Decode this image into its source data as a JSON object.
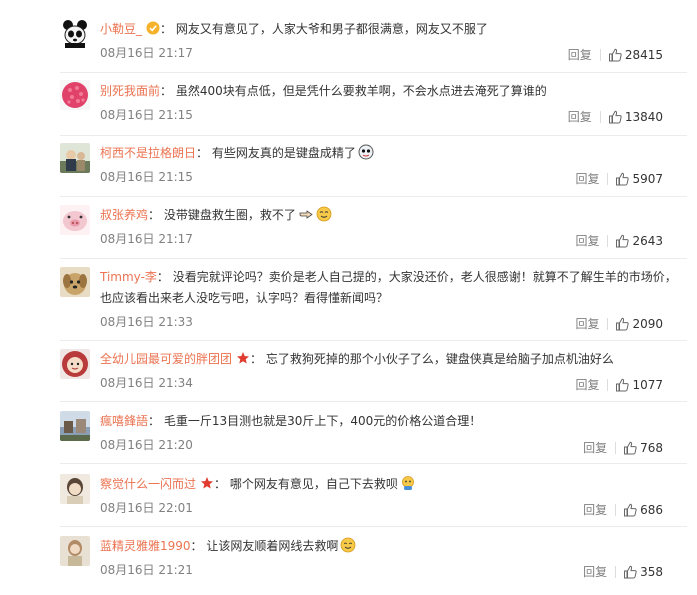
{
  "comments": [
    {
      "name": "小勒豆_",
      "text": "网友又有意见了，人家大爷和男子都很满意，网友又不服了",
      "time": "08月16日 21:17",
      "reply": "回复",
      "likes": "28415",
      "avatar_color": "#ffffff"
    },
    {
      "name": "别死我面前",
      "text": "虽然400块有点低，但是凭什么要救羊啊，不会水点进去淹死了算谁的",
      "time": "08月16日 21:15",
      "reply": "回复",
      "likes": "13840",
      "avatar_color": "#e0426a"
    },
    {
      "name": "柯西不是拉格朗日",
      "text": "有些网友真的是键盘成精了",
      "time": "08月16日 21:15",
      "reply": "回复",
      "likes": "5907",
      "avatar_color": "#6b7a5a"
    },
    {
      "name": "叔张养鸡",
      "text": "没带键盘救生圈，救不了",
      "time": "08月16日 21:17",
      "reply": "回复",
      "likes": "2643",
      "avatar_color": "#f3c7cf"
    },
    {
      "name": "Timmy-李",
      "text": "没看完就评论吗？卖价是老人自己提的，大家没还价，老人很感谢！就算不了解生羊的市场价，也应该看出来老人没吃亏吧，认字吗？看得懂新闻吗？",
      "time": "08月16日 21:33",
      "reply": "回复",
      "likes": "2090",
      "avatar_color": "#c9a46a"
    },
    {
      "name": "全幼儿园最可爱的胖团团",
      "text": "忘了救狗死掉的那个小伙子了么，键盘侠真是给脑子加点机油好么",
      "time": "08月16日 21:34",
      "reply": "回复",
      "likes": "1077",
      "avatar_color": "#b83a3a"
    },
    {
      "name": "瘋嘻鋒語",
      "text": "毛重一斤13目测也就是30斤上下，400元的价格公道合理！",
      "time": "08月16日 21:20",
      "reply": "回复",
      "likes": "768",
      "avatar_color": "#8a9fb5"
    },
    {
      "name": "察觉什么一闪而过",
      "text": "哪个网友有意见，自己下去救呗",
      "time": "08月16日 22:01",
      "reply": "回复",
      "likes": "686",
      "avatar_color": "#d9cdb8"
    },
    {
      "name": "蓝精灵雅雅1990",
      "text": "让该网友顺着网线去救啊",
      "time": "08月16日 21:21",
      "reply": "回复",
      "likes": "358",
      "avatar_color": "#c8b89a"
    }
  ],
  "colors": {
    "username": "#eb7350",
    "meta": "#808080",
    "text": "#333333",
    "separator": "#ececec"
  },
  "icons": {
    "like": "thumbs-up-icon",
    "verified": "verified-badge-icon",
    "star": "star-badge-icon"
  }
}
